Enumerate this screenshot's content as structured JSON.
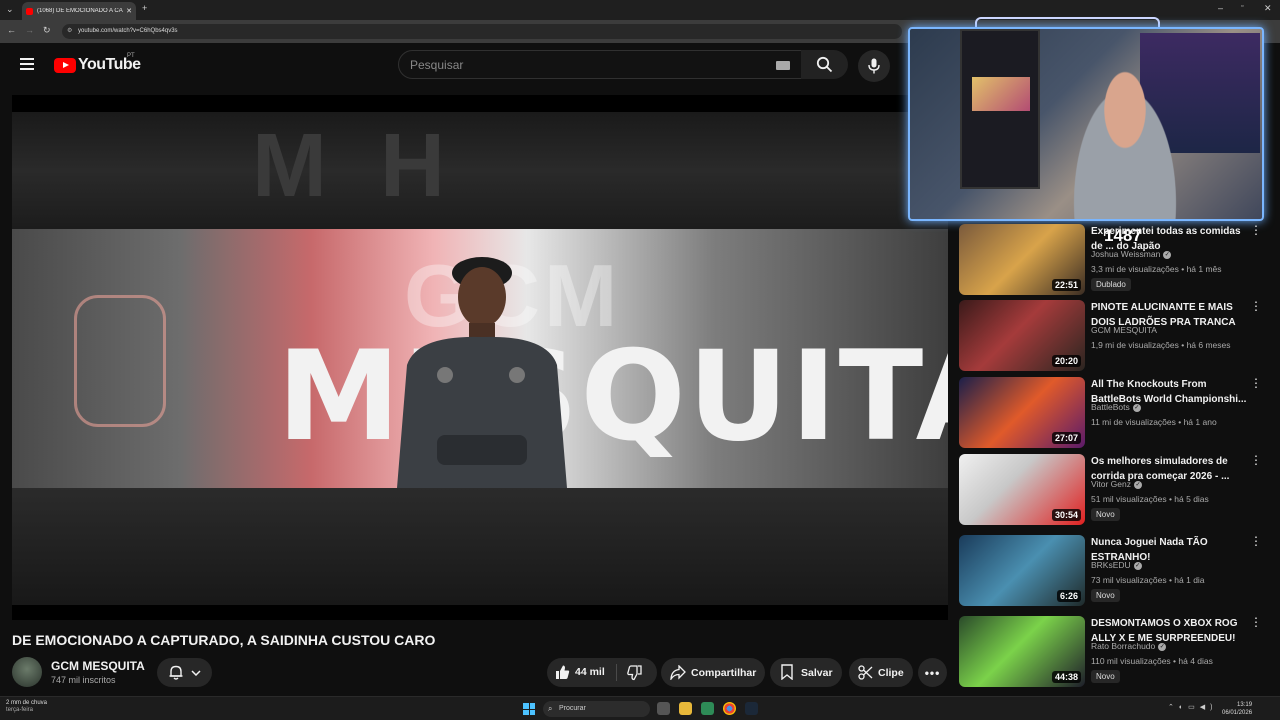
{
  "browser": {
    "tab_title": "(1068) DE EMOCIONADO A CA...",
    "url": "youtube.com/watch?v=C6hQbs4qv3s"
  },
  "header": {
    "logo_text": "YouTube",
    "country_code": "PT",
    "search_placeholder": "Pesquisar"
  },
  "video": {
    "overlay_top_word": "GCM",
    "overlay_main_word": "MESQUITA",
    "title": "DE EMOCIONADO A CAPTURADO, A SAIDINHA CUSTOU CARO",
    "channel": "GCM MESQUITA",
    "subscribers": "747 mil inscritos",
    "likes": "44 mil",
    "share_label": "Compartilhar",
    "save_label": "Salvar",
    "clip_label": "Clipe"
  },
  "webcam": {
    "counter": "1487"
  },
  "recommendations": [
    {
      "title": "Experimentei todas as comidas de ... do Japão",
      "channel": "Joshua Weissman",
      "verified": true,
      "meta": "3,3 mi de visualizações • há 1 mês",
      "badge": "Dublado",
      "duration": "22:51",
      "thumb": "linear-gradient(135deg,#7a5a3c,#d8a34a 50%,#3b2d24)"
    },
    {
      "title": "PINOTE ALUCINANTE E MAIS DOIS LADRÕES PRA TRANCA",
      "channel": "GCM MESQUITA",
      "verified": false,
      "meta": "1,9 mi de visualizações • há 6 meses",
      "badge": "",
      "duration": "20:20",
      "thumb": "linear-gradient(135deg,#3a1a1a,#a53b3b 45%,#2a2520)"
    },
    {
      "title": "All The Knockouts From BattleBots World Championshi...",
      "channel": "BattleBots",
      "verified": true,
      "meta": "11 mi de visualizações • há 1 ano",
      "badge": "",
      "duration": "27:07",
      "thumb": "linear-gradient(135deg,#1b1f4a,#e05a2a 50%,#5a1a6a)"
    },
    {
      "title": "Os melhores simuladores de corrida pra começar 2026 - ...",
      "channel": "Vitor Genz",
      "verified": true,
      "meta": "51 mil visualizações • há 5 dias",
      "badge": "Novo",
      "duration": "30:54",
      "thumb": "linear-gradient(135deg,#f0f0f0,#c8c8c8 40%,#e02020)"
    },
    {
      "title": "Nunca Joguei Nada TÃO ESTRANHO!",
      "channel": "BRKsEDU",
      "verified": true,
      "meta": "73 mil visualizações • há 1 dia",
      "badge": "Novo",
      "duration": "6:26",
      "thumb": "linear-gradient(135deg,#1a3b5a,#4a8fb0 50%,#1f2a2a)"
    },
    {
      "title": "DESMONTAMOS O XBOX ROG ALLY X E ME SURPREENDEU!",
      "channel": "Rato Borrachudo",
      "verified": true,
      "meta": "110 mil visualizações • há 4 dias",
      "badge": "Novo",
      "duration": "44:38",
      "thumb": "linear-gradient(135deg,#2a4a2a,#7bd24a 45%,#1e1e2a)"
    }
  ],
  "taskbar": {
    "weather_line1": "2 mm de chuva",
    "weather_line2": "terça-feira",
    "search_label": "Procurar",
    "time": "13:19",
    "date": "06/01/2026"
  }
}
